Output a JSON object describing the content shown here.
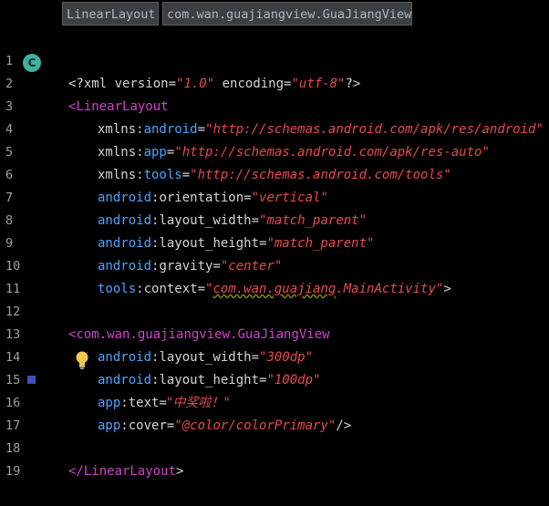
{
  "tabs": [
    {
      "label": "LinearLayout"
    },
    {
      "label": "com.wan.guajiangview.GuaJiangView"
    }
  ],
  "gutter": {
    "class_badge_label": "C",
    "bulb_icon": "lightbulb-icon",
    "color_swatch": "#3f51b5"
  },
  "lines": [
    {
      "n": "1"
    },
    {
      "n": "2"
    },
    {
      "n": "3"
    },
    {
      "n": "4"
    },
    {
      "n": "5"
    },
    {
      "n": "6"
    },
    {
      "n": "7"
    },
    {
      "n": "8"
    },
    {
      "n": "9"
    },
    {
      "n": "10"
    },
    {
      "n": "11"
    },
    {
      "n": "12"
    },
    {
      "n": "13"
    },
    {
      "n": "14"
    },
    {
      "n": "15"
    },
    {
      "n": "16"
    },
    {
      "n": "17"
    },
    {
      "n": "18"
    },
    {
      "n": "19"
    }
  ],
  "code": {
    "l1": {
      "a": "<?xml version=",
      "b": "\"1.0\"",
      "c": " encoding=",
      "d": "\"utf-8\"",
      "e": "?>"
    },
    "l2": {
      "a": "<",
      "b": "LinearLayout"
    },
    "l3": {
      "a": "xmlns:",
      "b": "android",
      "c": "=",
      "d": "\"http://schemas.android.com/apk/res/android\""
    },
    "l4": {
      "a": "xmlns:",
      "b": "app",
      "c": "=",
      "d": "\"http://schemas.android.com/apk/res-auto\""
    },
    "l5": {
      "a": "xmlns:",
      "b": "tools",
      "c": "=",
      "d": "\"http://schemas.android.com/tools\""
    },
    "l6": {
      "a": "android",
      "b": ":orientation=",
      "c": "\"vertical\""
    },
    "l7": {
      "a": "android",
      "b": ":layout_width=",
      "c": "\"match_parent\""
    },
    "l8": {
      "a": "android",
      "b": ":layout_height=",
      "c": "\"match_parent\""
    },
    "l9": {
      "a": "android",
      "b": ":gravity=",
      "c": "\"center\""
    },
    "l10": {
      "a": "tools",
      "b": ":context=",
      "c": "\"",
      "d": "com.wan.guajiang",
      "e": ".MainActivity\"",
      "f": ">"
    },
    "l12": {
      "a": "<",
      "b": "com.wan.guajiangview.GuaJiangView"
    },
    "l13": {
      "a": "android",
      "b": ":layout_width=",
      "c": "\"300dp\""
    },
    "l14": {
      "a": "android",
      "b": ":layout_height=",
      "c": "\"100dp\""
    },
    "l15": {
      "a": "app",
      "b": ":text=",
      "c": "\"中奖啦！\""
    },
    "l16": {
      "a": "app",
      "b": ":cover=",
      "c": "\"@color/colorPrimary\"",
      "d": "/>"
    },
    "l18": {
      "a": "</",
      "b": "LinearLayout",
      "c": ">"
    }
  }
}
